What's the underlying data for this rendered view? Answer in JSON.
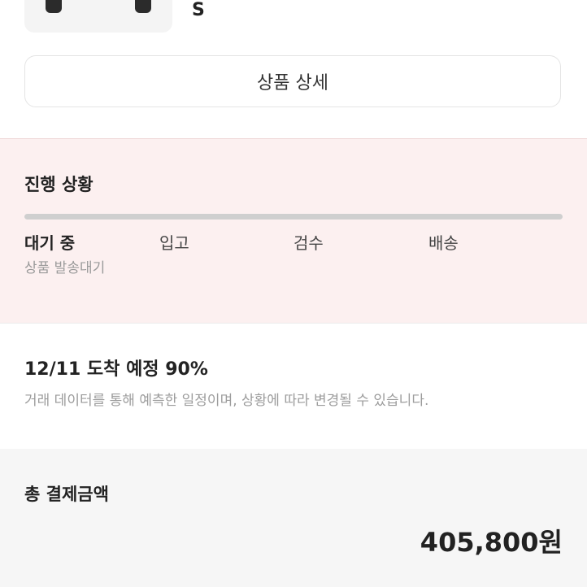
{
  "product": {
    "size": "S",
    "detail_button_label": "상품 상세"
  },
  "progress": {
    "title": "진행 상황",
    "steps": [
      {
        "label": "대기 중",
        "active": true
      },
      {
        "label": "입고",
        "active": false
      },
      {
        "label": "검수",
        "active": false
      },
      {
        "label": "배송",
        "active": false
      }
    ],
    "current_status": "상품 발송대기",
    "progress_fraction": 1.0
  },
  "eta": {
    "title": "12/11 도착 예정 90%",
    "description": "거래 데이터를 통해 예측한 일정이며, 상황에 따라 변경될 수 있습니다."
  },
  "payment": {
    "label": "총 결제금액",
    "amount": "405,800원"
  }
}
